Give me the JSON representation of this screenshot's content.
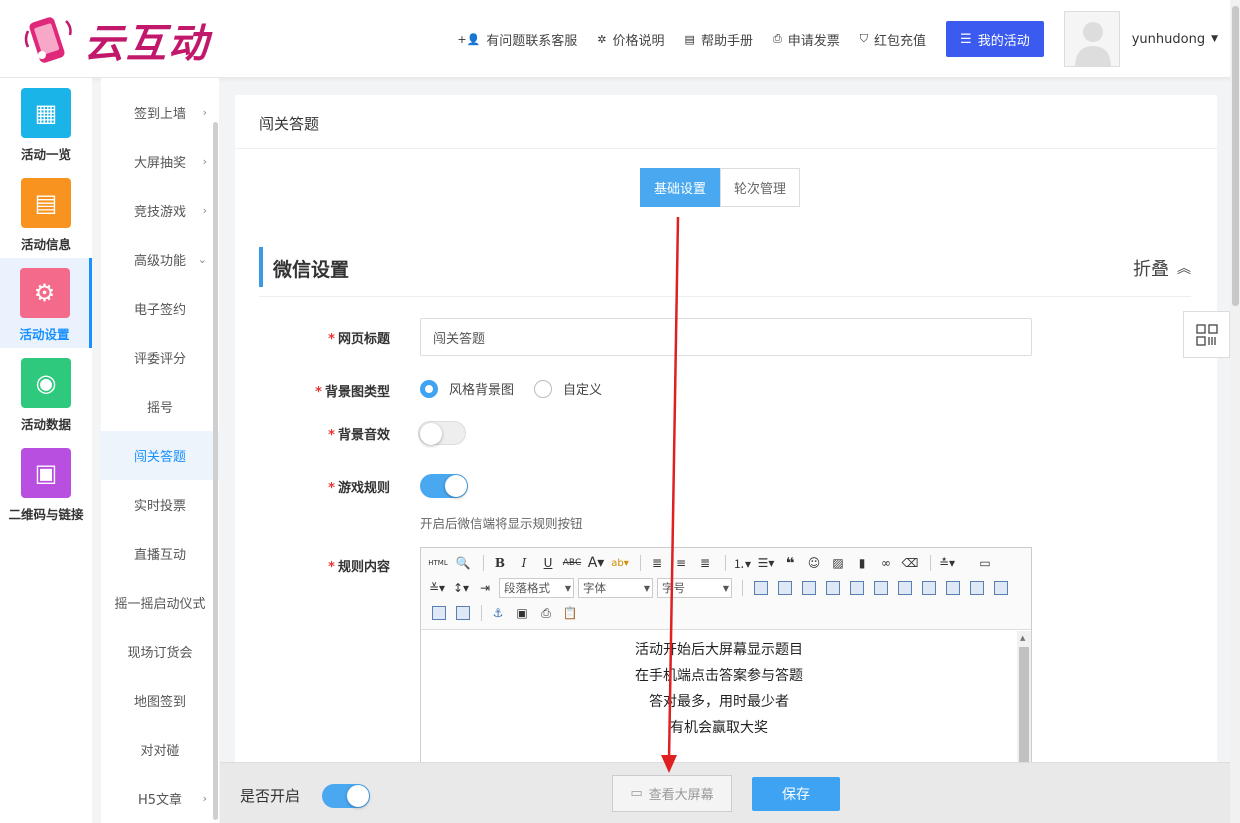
{
  "brand": {
    "name": "云互动"
  },
  "top_nav": {
    "links": [
      {
        "label": "有问题联系客服",
        "icon": "add-user-icon"
      },
      {
        "label": "价格说明",
        "icon": "gear-badge-icon"
      },
      {
        "label": "帮助手册",
        "icon": "book-icon"
      },
      {
        "label": "申请发票",
        "icon": "printer-icon"
      },
      {
        "label": "红包充值",
        "icon": "shield-check-icon"
      }
    ],
    "my_activity": "我的活动",
    "username": "yunhudong"
  },
  "iconbar": {
    "items": [
      {
        "label": "活动一览",
        "color": "#1ab4e8",
        "icon": "grid-icon"
      },
      {
        "label": "活动信息",
        "color": "#f7931e",
        "icon": "document-icon"
      },
      {
        "label": "活动设置",
        "color": "#f46a8a",
        "icon": "gear-icon",
        "active": true
      },
      {
        "label": "活动数据",
        "color": "#2fc97e",
        "icon": "database-icon"
      },
      {
        "label": "二维码与链接",
        "color": "#b84fe0",
        "icon": "qrcode-icon"
      }
    ]
  },
  "submenu": {
    "items": [
      {
        "label": "签到上墙",
        "arrow": "›"
      },
      {
        "label": "大屏抽奖",
        "arrow": "›"
      },
      {
        "label": "竞技游戏",
        "arrow": "›"
      },
      {
        "label": "高级功能",
        "arrow": "⌄"
      },
      {
        "label": "电子签约"
      },
      {
        "label": "评委评分"
      },
      {
        "label": "摇号"
      },
      {
        "label": "闯关答题",
        "active": true
      },
      {
        "label": "实时投票"
      },
      {
        "label": "直播互动"
      },
      {
        "label": "摇一摇启动仪式"
      },
      {
        "label": "现场订货会"
      },
      {
        "label": "地图签到"
      },
      {
        "label": "对对碰"
      },
      {
        "label": "H5文章",
        "arrow": "›"
      }
    ]
  },
  "panel": {
    "title": "闯关答题",
    "tabs": [
      "基础设置",
      "轮次管理"
    ],
    "active_tab": 0,
    "section_title": "微信设置",
    "collapse_label": "折叠"
  },
  "form": {
    "page_title": {
      "label": "网页标题",
      "value": "闯关答题"
    },
    "bg_type": {
      "label": "背景图类型",
      "options": [
        "风格背景图",
        "自定义"
      ],
      "selected": 0
    },
    "bg_sound": {
      "label": "背景音效",
      "enabled": false
    },
    "rules": {
      "label": "游戏规则",
      "enabled": true,
      "hint": "开启后微信端将显示规则按钮"
    },
    "rules_content": {
      "label": "规则内容",
      "toolbar": {
        "paragraph": "段落格式",
        "font": "字体",
        "size": "字号",
        "html": "HTML"
      },
      "lines": [
        "活动开始后大屏幕显示题目",
        "在手机端点击答案参与答题",
        "答对最多，用时最少者",
        "有机会赢取大奖"
      ]
    }
  },
  "bottom": {
    "enable_label": "是否开启",
    "enabled": true,
    "view_screen": "查看大屏幕",
    "save": "保存"
  },
  "colors": {
    "accent": "#3ea3f3",
    "primary_button": "#3b5bf0",
    "arrow": "#e02020"
  }
}
